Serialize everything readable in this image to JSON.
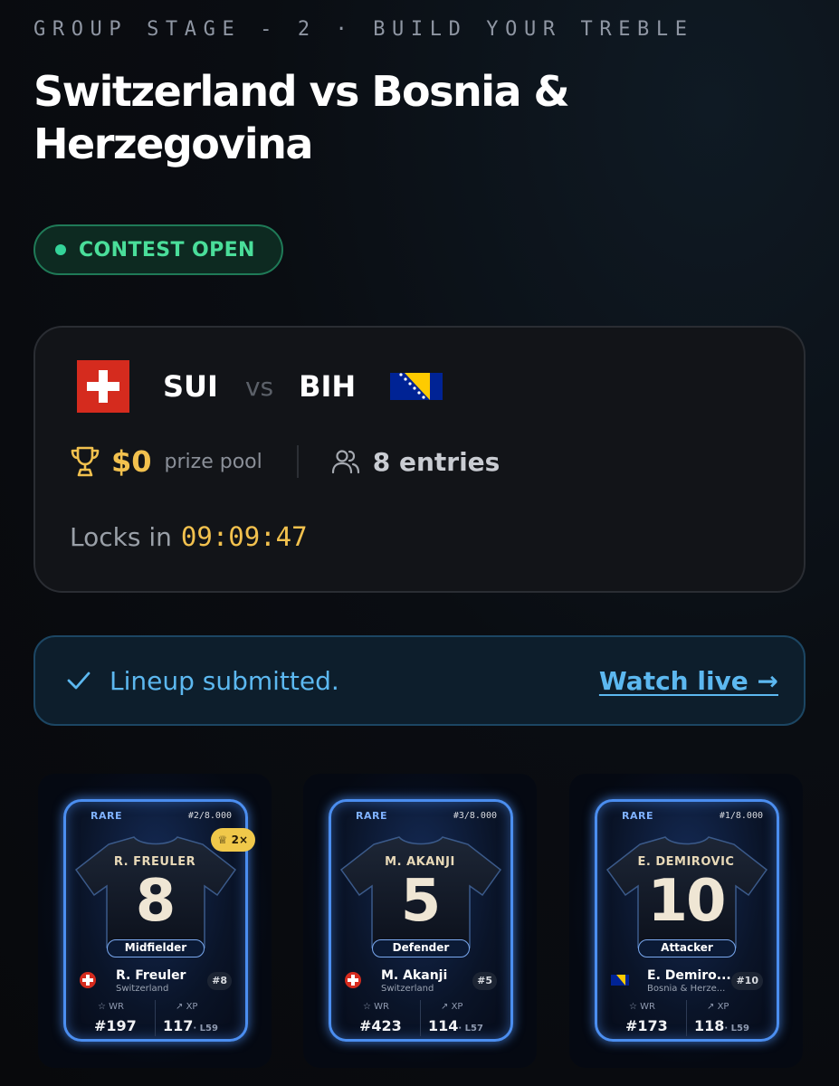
{
  "header": {
    "eyebrow": "GROUP STAGE - 2 · BUILD YOUR TREBLE",
    "title": "Switzerland vs Bosnia & Herzegovina",
    "status": "CONTEST OPEN",
    "status_color": "#34d399"
  },
  "match": {
    "home_code": "SUI",
    "vs": "vs",
    "away_code": "BIH",
    "prize_amount": "$0",
    "prize_label": "prize pool",
    "entries": "8 entries",
    "locks_label": "Locks in",
    "locks_timer": "09:09:47",
    "icons": [
      "trophy-icon",
      "users-icon"
    ]
  },
  "banner": {
    "message": "Lineup submitted.",
    "link": "Watch live →",
    "icon": "check-icon"
  },
  "cards": [
    {
      "rarity": "RARE",
      "serial": "#2/8.000",
      "short_name": "R. FREULER",
      "number": "8",
      "position": "Midfielder",
      "multiplier": "2×",
      "name": "R. Freuler",
      "country": "Switzerland",
      "jersey": "#8",
      "wr_label": "WR",
      "wr_value": "#197",
      "xp_label": "XP",
      "xp_value": "117",
      "xp_sub": "· L59"
    },
    {
      "rarity": "RARE",
      "serial": "#3/8.000",
      "short_name": "M. AKANJI",
      "number": "5",
      "position": "Defender",
      "name": "M. Akanji",
      "country": "Switzerland",
      "jersey": "#5",
      "wr_label": "WR",
      "wr_value": "#423",
      "xp_label": "XP",
      "xp_value": "114",
      "xp_sub": "· L57"
    },
    {
      "rarity": "RARE",
      "serial": "#1/8.000",
      "short_name": "E. DEMIROVIC",
      "number": "10",
      "position": "Attacker",
      "name": "E. Demiro...",
      "country": "Bosnia & Herze...",
      "jersey": "#10",
      "wr_label": "WR",
      "wr_value": "#173",
      "xp_label": "XP",
      "xp_value": "118",
      "xp_sub": "· L59"
    }
  ],
  "colors": {
    "accent_gold": "#f2c14e",
    "accent_blue": "#5cb8f0",
    "card_glow": "#4b8ef0"
  }
}
